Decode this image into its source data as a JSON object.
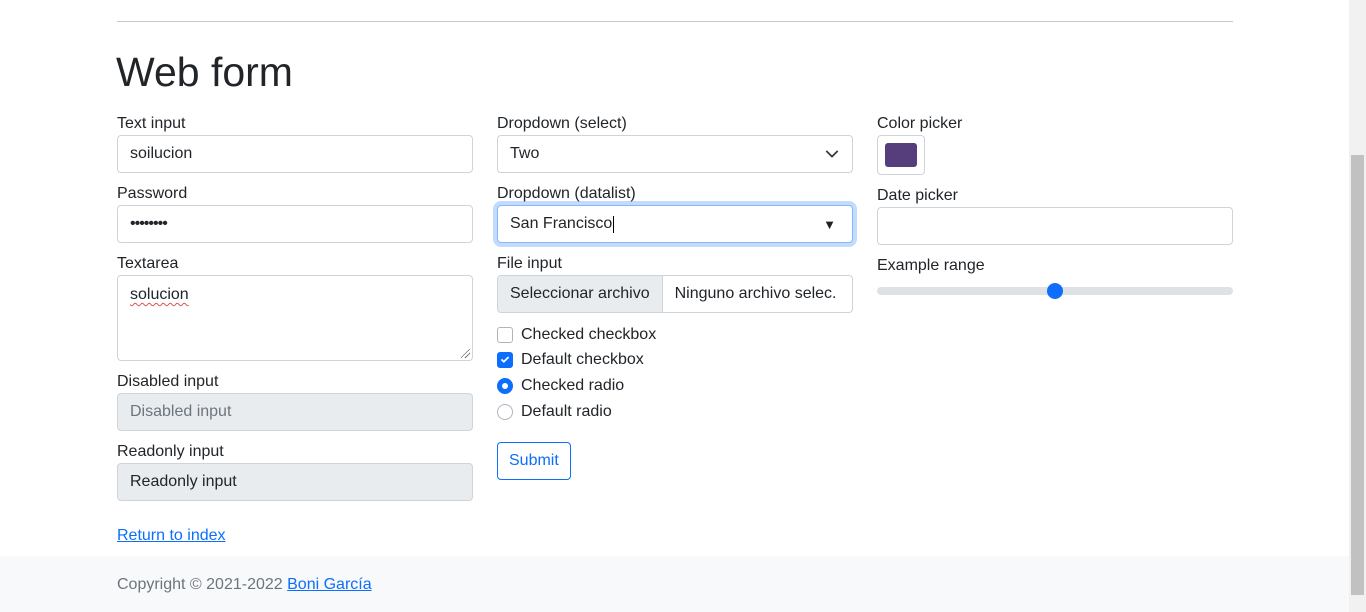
{
  "page": {
    "title": "Web form"
  },
  "form": {
    "text_input": {
      "label": "Text input",
      "value": "soilucion"
    },
    "password": {
      "label": "Password",
      "masked_value": "••••••••"
    },
    "textarea": {
      "label": "Textarea",
      "value": "solucion"
    },
    "disabled_input": {
      "label": "Disabled input",
      "placeholder": "Disabled input"
    },
    "readonly_input": {
      "label": "Readonly input",
      "value": "Readonly input"
    },
    "select": {
      "label": "Dropdown (select)",
      "selected": "Two"
    },
    "datalist": {
      "label": "Dropdown (datalist)",
      "value": "San Francisco"
    },
    "file_input": {
      "label": "File input",
      "button_label": "Seleccionar archivo",
      "file_status": "Ninguno archivo selec."
    },
    "checkboxes": [
      {
        "label": "Checked checkbox",
        "checked": false
      },
      {
        "label": "Default checkbox",
        "checked": true
      }
    ],
    "radios": [
      {
        "label": "Checked radio",
        "selected": true
      },
      {
        "label": "Default radio",
        "selected": false
      }
    ],
    "submit_label": "Submit",
    "color_picker": {
      "label": "Color picker",
      "value": "#563d7c"
    },
    "date_picker": {
      "label": "Date picker",
      "value": ""
    },
    "range": {
      "label": "Example range",
      "value": 5,
      "min": 0,
      "max": 10
    }
  },
  "links": {
    "return_to_index": "Return to index"
  },
  "footer": {
    "copyright": "Copyright © 2021-2022",
    "author": "Boni García"
  },
  "colors": {
    "primary": "#0d6efd",
    "disabled_bg": "#e9ecef",
    "footer_bg": "#f8f9fa"
  }
}
